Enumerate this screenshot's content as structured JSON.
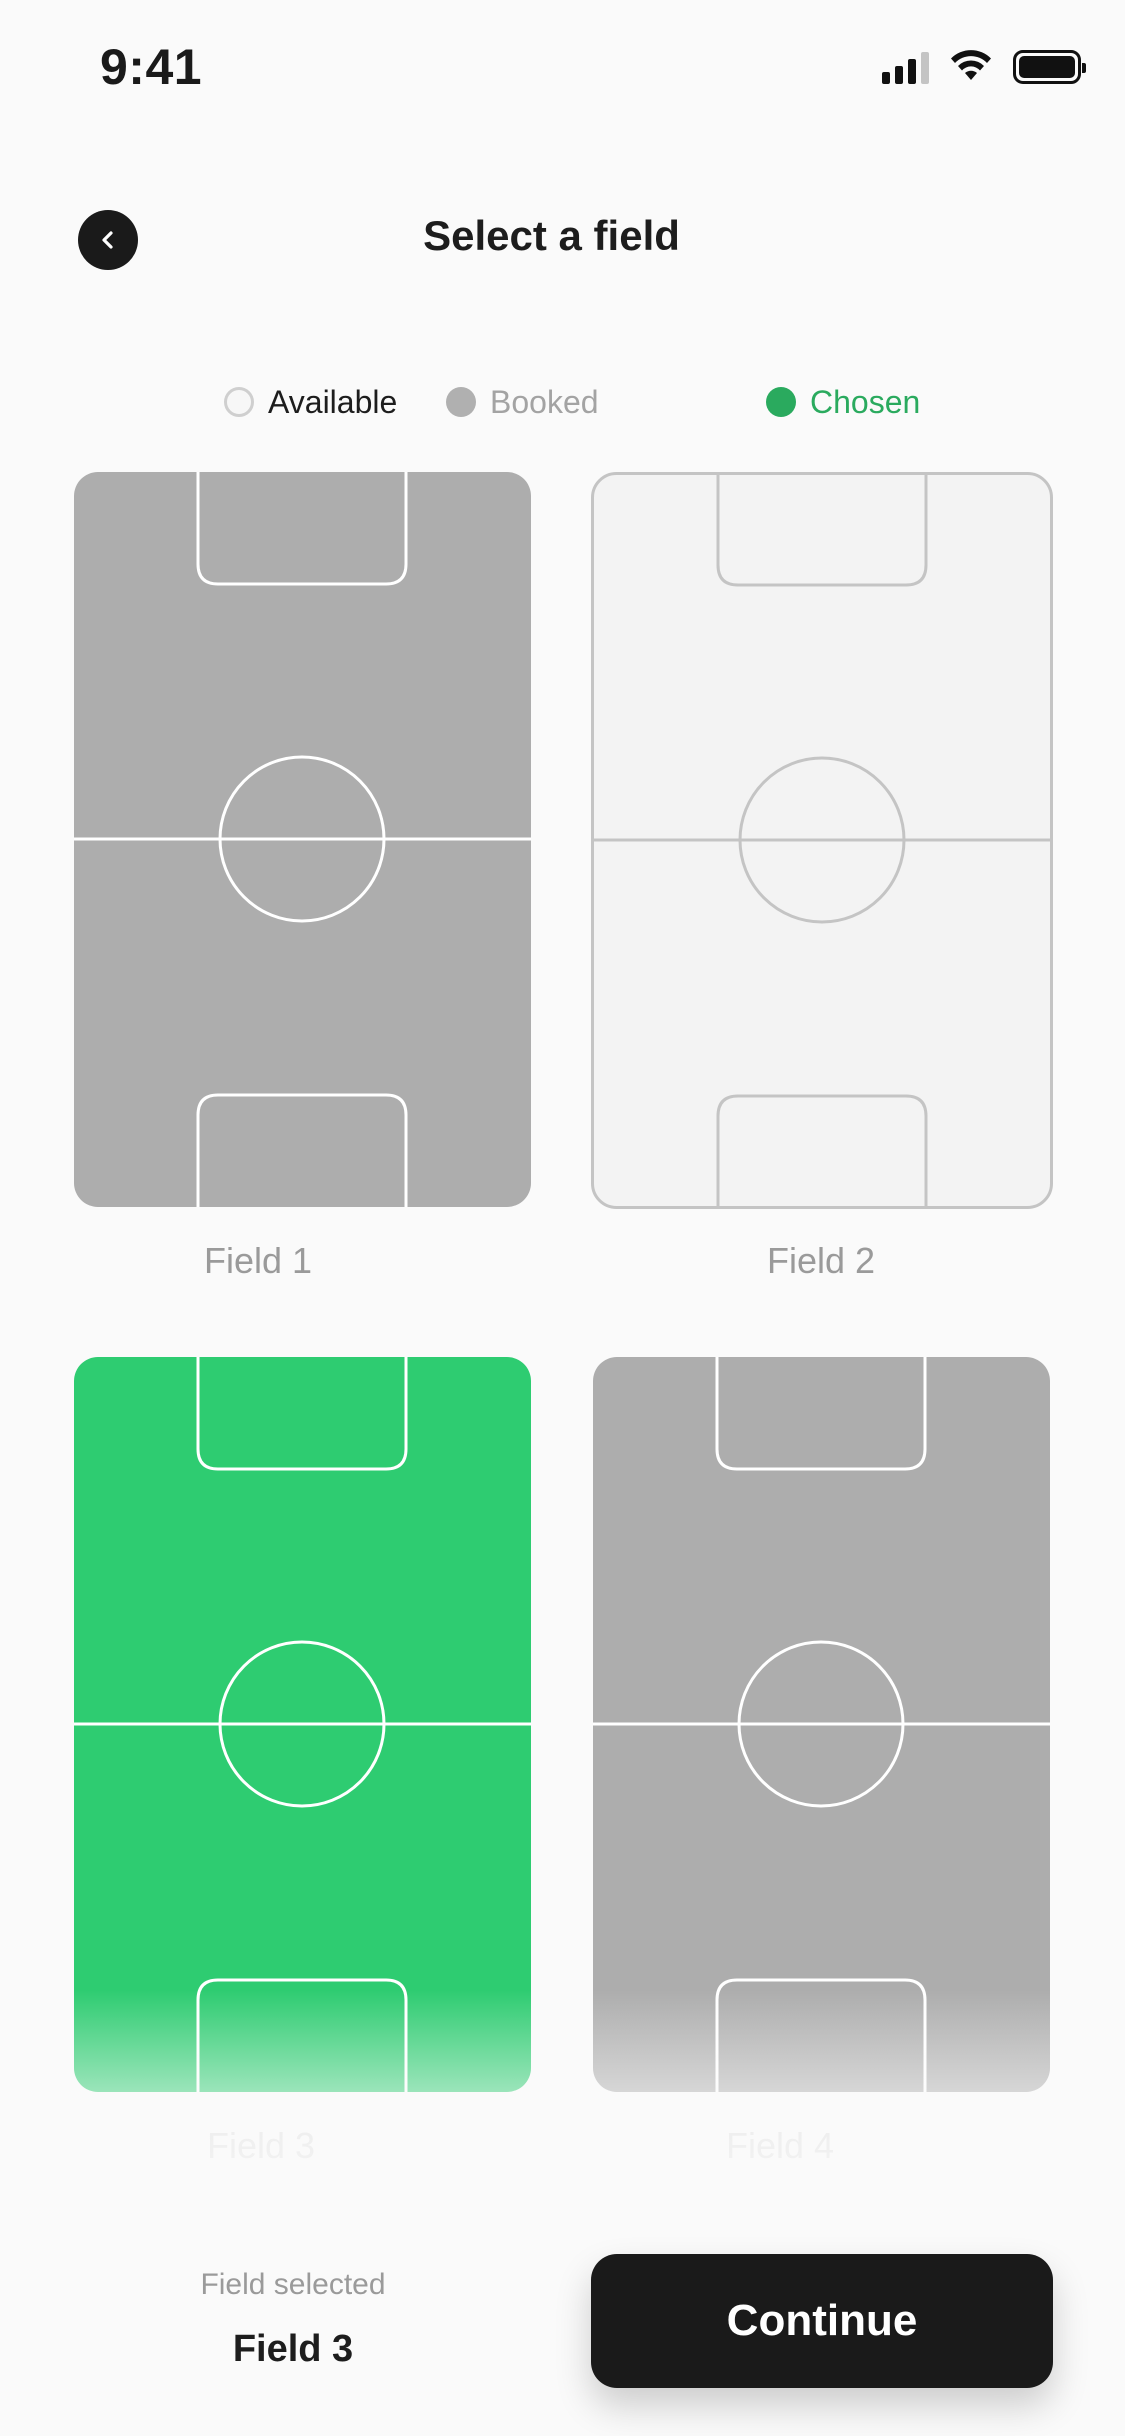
{
  "status_bar": {
    "time": "9:41",
    "icons": [
      "signal-icon",
      "wifi-icon",
      "battery-icon"
    ]
  },
  "header": {
    "back_icon": "chevron-left-icon",
    "title": "Select a field"
  },
  "legend": {
    "available": "Available",
    "booked": "Booked",
    "chosen": "Chosen"
  },
  "fields": [
    {
      "label": "Field 1",
      "status": "booked"
    },
    {
      "label": "Field 2",
      "status": "available"
    },
    {
      "label": "Field 3",
      "status": "chosen"
    },
    {
      "label": "Field 4",
      "status": "booked"
    }
  ],
  "footer": {
    "caption": "Field selected",
    "selected_field": "Field 3",
    "continue_label": "Continue"
  },
  "colors": {
    "background": "#fafafa",
    "booked": "#adadad",
    "available": "#f3f3f3",
    "chosen": "#2ecc71",
    "chosen_text": "#2aaa5e",
    "button": "#1a1a1a"
  }
}
